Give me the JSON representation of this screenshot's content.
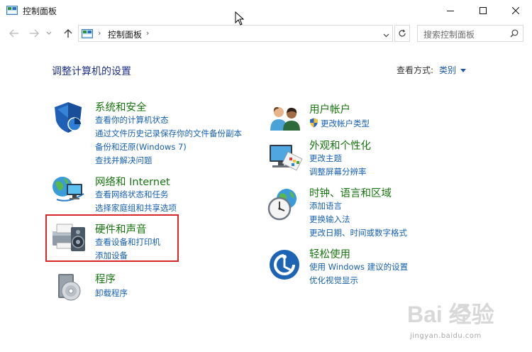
{
  "window": {
    "title": "控制面板",
    "controls": [
      "minimize-icon",
      "maximize-icon",
      "close-icon"
    ]
  },
  "nav": {
    "breadcrumb_separator": "›",
    "breadcrumb": "控制面板",
    "search_placeholder": "搜索控制面板"
  },
  "content": {
    "heading": "调整计算机的设置",
    "view_by_label": "查看方式:",
    "view_by_value": "类别",
    "left_categories": [
      {
        "title": "系统和安全",
        "icon": "shield-icon",
        "links": [
          "查看你的计算机状态",
          "通过文件历史记录保存你的文件备份副本",
          "备份和还原(Windows 7)",
          "查找并解决问题"
        ]
      },
      {
        "title": "网络和 Internet",
        "icon": "network-globe-icon",
        "links": [
          "查看网络状态和任务",
          "选择家庭组和共享选项"
        ]
      },
      {
        "title": "硬件和声音",
        "icon": "printer-speaker-icon",
        "links": [
          "查看设备和打印机",
          "添加设备"
        ]
      },
      {
        "title": "程序",
        "icon": "programs-disc-icon",
        "links": [
          "卸载程序"
        ]
      }
    ],
    "right_categories": [
      {
        "title": "用户帐户",
        "icon": "users-icon",
        "links": [
          "更改帐户类型"
        ]
      },
      {
        "title": "外观和个性化",
        "icon": "display-paint-icon",
        "links": [
          "更改主题",
          "调整屏幕分辨率"
        ]
      },
      {
        "title": "时钟、语言和区域",
        "icon": "clock-globe-icon",
        "links": [
          "添加语言",
          "更换输入法",
          "更改日期、时间或数字格式"
        ]
      },
      {
        "title": "轻松使用",
        "icon": "ease-of-access-icon",
        "links": [
          "使用 Windows 建议的设置",
          "优化视觉显示"
        ]
      }
    ]
  },
  "watermark": {
    "brand": "Bai  经验",
    "url": "jingyan.baidu.com"
  },
  "colors": {
    "category_title": "#17750f",
    "link": "#1660b0",
    "heading": "#1e3287",
    "highlight_box": "#d6262a"
  }
}
